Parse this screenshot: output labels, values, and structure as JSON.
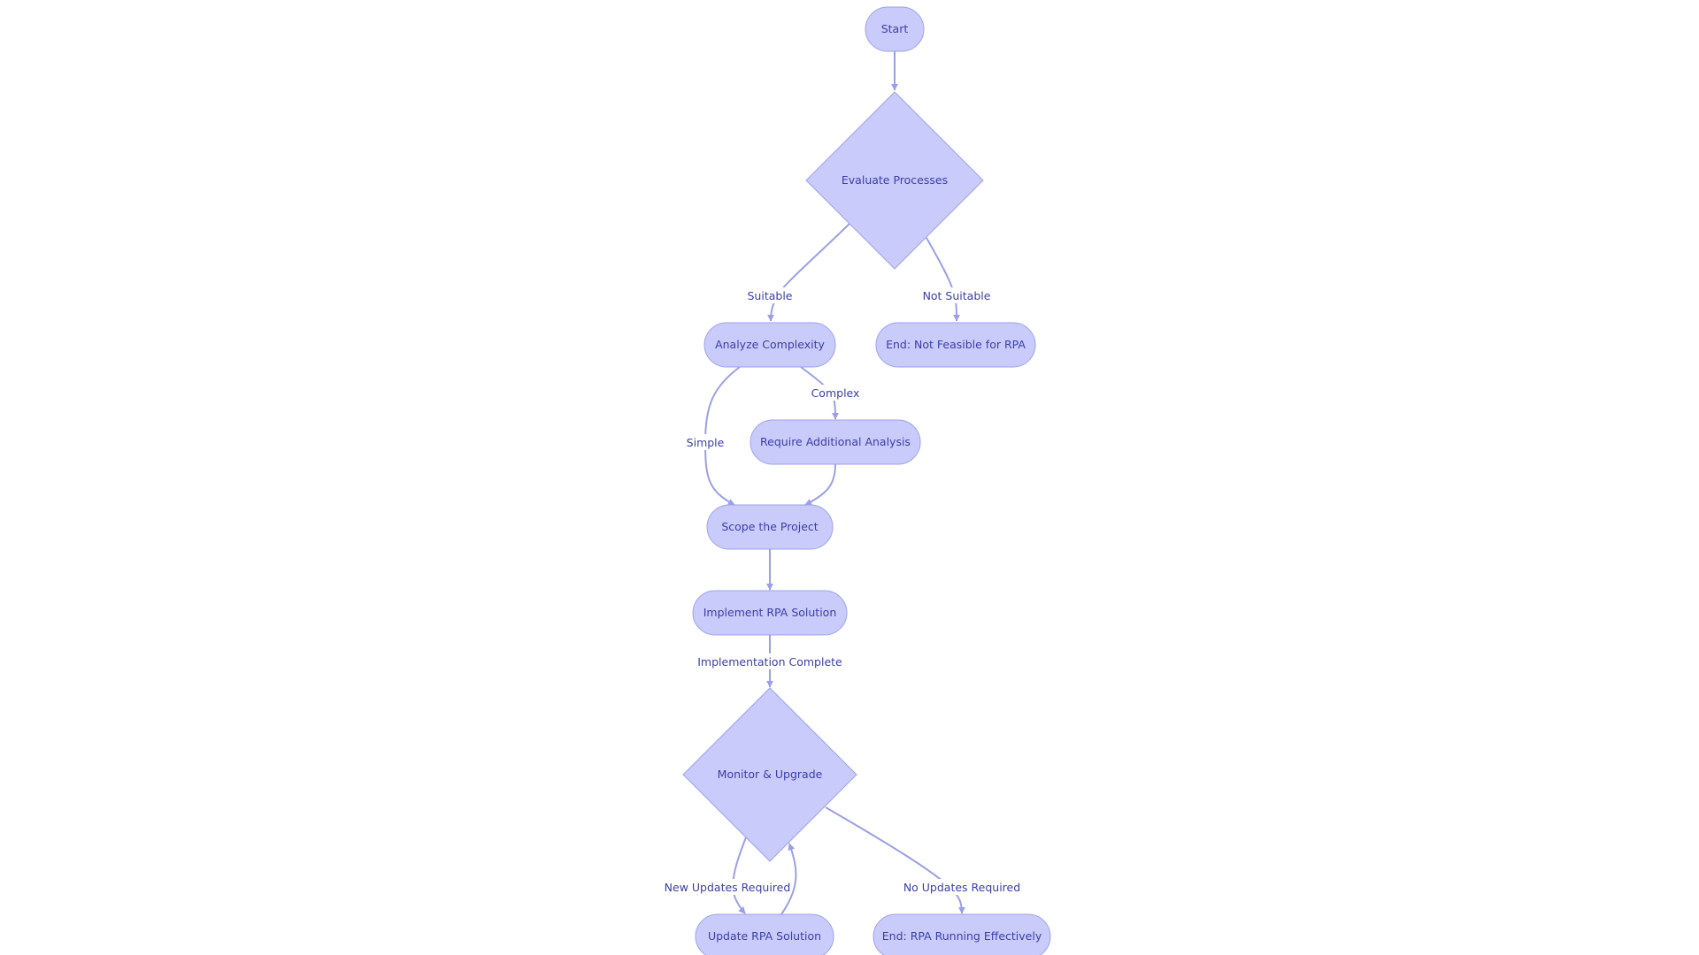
{
  "diagram": {
    "type": "flowchart",
    "direction": "top-down",
    "colors": {
      "node_fill": "#c9cbfb",
      "node_stroke": "#9ea2ec",
      "text": "#3a3fa8",
      "edge": "#9b9fe6",
      "background": "#ffffff"
    },
    "nodes": [
      {
        "id": "start",
        "label": "Start",
        "shape": "stadium"
      },
      {
        "id": "evaluate",
        "label": "Evaluate Processes",
        "shape": "diamond"
      },
      {
        "id": "analyze",
        "label": "Analyze Complexity",
        "shape": "stadium"
      },
      {
        "id": "not_feasible",
        "label": "End: Not Feasible for RPA",
        "shape": "stadium"
      },
      {
        "id": "additional",
        "label": "Require Additional Analysis",
        "shape": "stadium"
      },
      {
        "id": "scope",
        "label": "Scope the Project",
        "shape": "stadium"
      },
      {
        "id": "implement",
        "label": "Implement RPA Solution",
        "shape": "stadium"
      },
      {
        "id": "monitor",
        "label": "Monitor & Upgrade",
        "shape": "diamond"
      },
      {
        "id": "update",
        "label": "Update RPA Solution",
        "shape": "stadium"
      },
      {
        "id": "running",
        "label": "End: RPA Running Effectively",
        "shape": "stadium"
      }
    ],
    "edges": [
      {
        "from": "start",
        "to": "evaluate",
        "label": ""
      },
      {
        "from": "evaluate",
        "to": "analyze",
        "label": "Suitable"
      },
      {
        "from": "evaluate",
        "to": "not_feasible",
        "label": "Not Suitable"
      },
      {
        "from": "analyze",
        "to": "scope",
        "label": "Simple"
      },
      {
        "from": "analyze",
        "to": "additional",
        "label": "Complex"
      },
      {
        "from": "additional",
        "to": "scope",
        "label": ""
      },
      {
        "from": "scope",
        "to": "implement",
        "label": ""
      },
      {
        "from": "implement",
        "to": "monitor",
        "label": "Implementation Complete"
      },
      {
        "from": "monitor",
        "to": "update",
        "label": "New Updates Required"
      },
      {
        "from": "update",
        "to": "monitor",
        "label": ""
      },
      {
        "from": "monitor",
        "to": "running",
        "label": "No Updates Required"
      }
    ]
  }
}
